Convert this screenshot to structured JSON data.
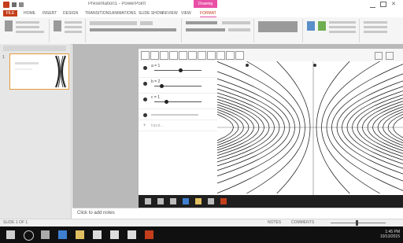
{
  "app": {
    "title": "Presentation1 - PowerPoint",
    "context_tab": "Drawing Tools"
  },
  "ribbon_tabs": [
    "FILE",
    "HOME",
    "INSERT",
    "DESIGN",
    "TRANSITIONS",
    "ANIMATIONS",
    "SLIDE SHOW",
    "REVIEW",
    "VIEW",
    "FORMAT"
  ],
  "slides": [
    {
      "number": "1"
    }
  ],
  "geogebra": {
    "sliders": [
      {
        "label": "a = 1",
        "value_fraction": 0.55
      },
      {
        "label": "b = 2",
        "value_fraction": 0.15
      },
      {
        "label": "c = 1",
        "value_fraction": 0.25
      }
    ],
    "input_placeholder": "Input..."
  },
  "notes": {
    "placeholder": "Click to add notes"
  },
  "status": {
    "slide_info": "SLIDE 1 OF 1",
    "notes_label": "NOTES",
    "comments_label": "COMMENTS"
  },
  "clock": {
    "time": "1:45 PM",
    "date": "10/13/2015"
  },
  "colors": {
    "accent": "#c43e1c",
    "context": "#e84fa6",
    "selection": "#e59a3a"
  }
}
